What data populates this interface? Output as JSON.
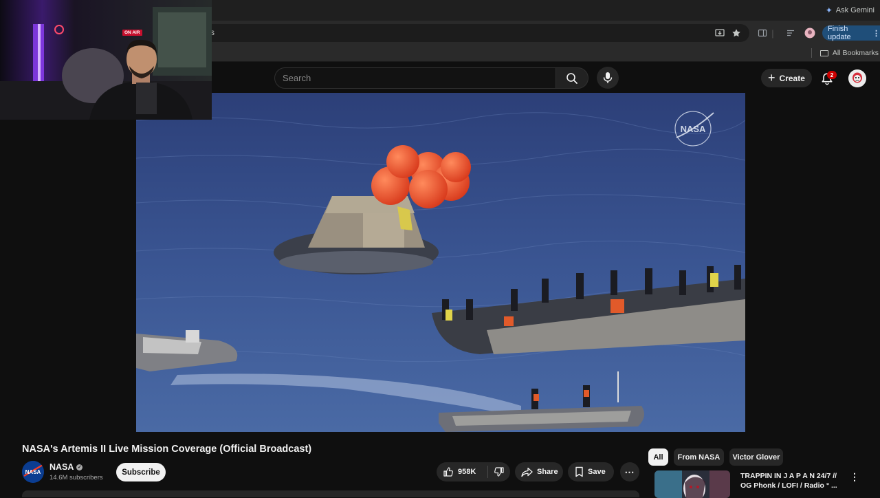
{
  "browser": {
    "tab_fragment": "s",
    "ask_gemini": "Ask Gemini",
    "finish_update": "Finish update",
    "all_bookmarks": "All Bookmarks"
  },
  "stream_overlay": {
    "on_air": "ON AIR"
  },
  "header": {
    "search_placeholder": "Search",
    "create_label": "Create",
    "notification_count": "2"
  },
  "video": {
    "watermark": "NASA",
    "title": "NASA's Artemis II Live Mission Coverage (Official Broadcast)"
  },
  "channel": {
    "name": "NASA",
    "avatar_text": "NASA",
    "subscribers": "14.6M subscribers",
    "subscribe_label": "Subscribe"
  },
  "actions": {
    "likes": "958K",
    "share_label": "Share",
    "save_label": "Save"
  },
  "chips": {
    "all": "All",
    "from_nasa": "From NASA",
    "victor": "Victor Glover"
  },
  "recommendation": {
    "title": "TRAPPIN IN  J A P A N  24/7 // OG Phonk / LOFI / Radio ° ...",
    "meta": ""
  },
  "colors": {
    "background": "#0f0f0f",
    "surface": "#272727",
    "accent_red": "#cc0000",
    "update_blue": "#1f4e79"
  },
  "icons": {
    "search": "search-icon",
    "mic": "mic-icon",
    "bell": "bell-icon",
    "like": "thumbs-up-icon",
    "dislike": "thumbs-down-icon",
    "share": "share-arrow-icon",
    "save": "bookmark-icon",
    "more": "more-horizontal-icon"
  }
}
